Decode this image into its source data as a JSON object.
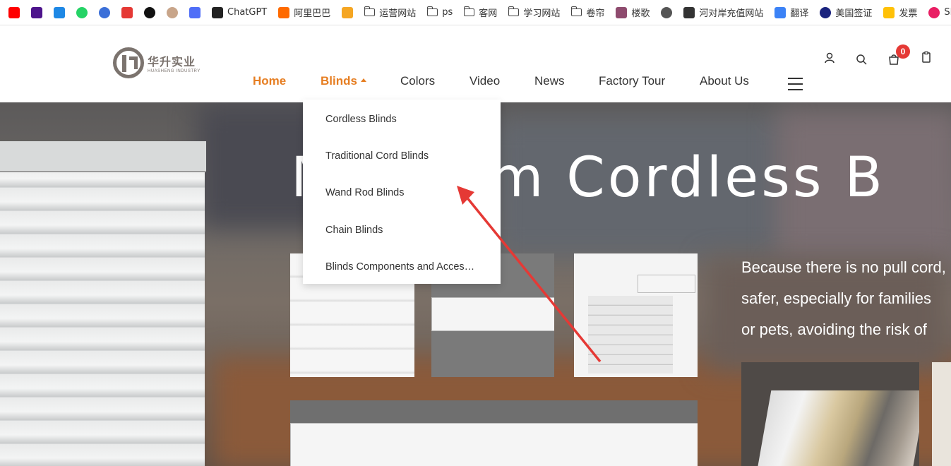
{
  "bookmarks": [
    {
      "icon": "youtube-icon",
      "label": "",
      "color": "#ff0000"
    },
    {
      "icon": "fedex-icon",
      "label": "",
      "color": "#4d148c"
    },
    {
      "icon": "translate-icon",
      "label": "",
      "color": "#1e88e5"
    },
    {
      "icon": "whatsapp-icon",
      "label": "",
      "color": "#25d366"
    },
    {
      "icon": "app-icon",
      "label": "",
      "color": "#3b6fd8"
    },
    {
      "icon": "heart-icon",
      "label": "",
      "color": "#e53935"
    },
    {
      "icon": "openai-icon",
      "label": "",
      "color": "#111111"
    },
    {
      "icon": "avatar-icon",
      "label": "",
      "color": "#c8a58a"
    },
    {
      "icon": "swirl-icon",
      "label": "",
      "color": "#4f6ef7"
    },
    {
      "icon": "chatgpt-icon",
      "label": "ChatGPT",
      "color": "#222222"
    },
    {
      "icon": "alibaba-icon",
      "label": "阿里巴巴",
      "color": "#ff6a00"
    },
    {
      "icon": "shop-icon",
      "label": "",
      "color": "#f5a623"
    },
    {
      "icon": "folder-icon",
      "label": "运营网站",
      "color": "#444444"
    },
    {
      "icon": "folder-icon",
      "label": "ps",
      "color": "#444444"
    },
    {
      "icon": "folder-icon",
      "label": "客网",
      "color": "#444444"
    },
    {
      "icon": "folder-icon",
      "label": "学习网站",
      "color": "#444444"
    },
    {
      "icon": "folder-icon",
      "label": "卷帘",
      "color": "#444444"
    },
    {
      "icon": "lougou-icon",
      "label": "楼歌",
      "color": "#8e4b6e"
    },
    {
      "icon": "globe-icon",
      "label": "",
      "color": "#555555"
    },
    {
      "icon": "site-icon",
      "label": "河对岸充值网站",
      "color": "#333333"
    },
    {
      "icon": "translate2-icon",
      "label": "翻译",
      "color": "#3b82f6"
    },
    {
      "icon": "seal-icon",
      "label": "美国签证",
      "color": "#1a237e"
    },
    {
      "icon": "invoice-icon",
      "label": "发票",
      "color": "#ffc107"
    },
    {
      "icon": "sme-icon",
      "label": "SME",
      "color": "#e91e63"
    }
  ],
  "logo": {
    "cn": "华升实业",
    "en": "HUASHENG INDUSTRY"
  },
  "nav": {
    "items": [
      "Home",
      "Blinds",
      "Colors",
      "Video",
      "News",
      "Factory Tour",
      "About Us"
    ],
    "active": "Home",
    "open": "Blinds"
  },
  "cart_count": "0",
  "dropdown": [
    "Cordless Blinds",
    "Traditional Cord Blinds",
    "Wand Rod Blinds",
    "Chain Blinds",
    "Blinds Components and Accessories"
  ],
  "hero": {
    "title": "M      ystem Cordless B",
    "lines": [
      "Because there is no pull cord,",
      "safer, especially for families",
      "or pets, avoiding the risk of"
    ]
  },
  "colors": {
    "accent": "#e67e22",
    "badge": "#e53935",
    "arrow": "#e53935"
  }
}
